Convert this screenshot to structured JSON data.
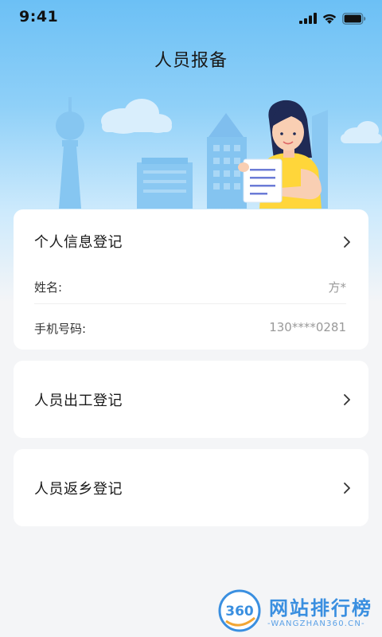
{
  "status_bar": {
    "time": "9:41"
  },
  "header": {
    "title": "人员报备"
  },
  "personal_info_card": {
    "title": "个人信息登记",
    "fields": [
      {
        "label": "姓名:",
        "value": "方*"
      },
      {
        "label": "手机号码:",
        "value": "130****0281"
      }
    ]
  },
  "work_card": {
    "title": "人员出工登记"
  },
  "home_card": {
    "title": "人员返乡登记"
  },
  "watermark": {
    "badge": "360",
    "title": "网站排行榜",
    "subtitle": "-WANGZHAN360.CN-"
  },
  "colors": {
    "sky_top": "#6cc0f5",
    "background": "#f4f5f7",
    "card": "#ffffff",
    "value_gray": "#999999",
    "watermark_blue": "#3a8fe0",
    "shirt_yellow": "#ffd63a"
  },
  "icons": {
    "chevron": "chevron-right-icon",
    "signal": "signal-icon",
    "wifi": "wifi-icon",
    "battery": "battery-icon"
  }
}
